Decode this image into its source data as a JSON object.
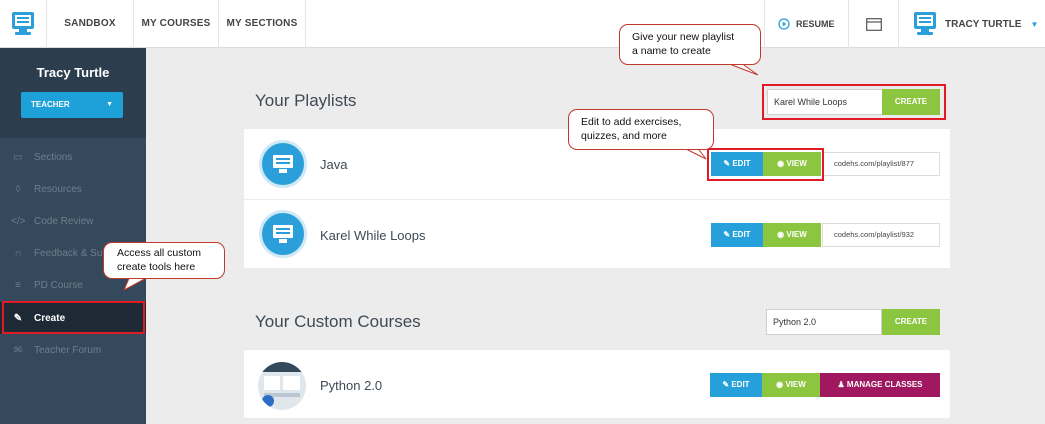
{
  "nav": {
    "items": [
      {
        "label": "SANDBOX"
      },
      {
        "label": "MY COURSES"
      },
      {
        "label": "MY SECTIONS"
      }
    ],
    "resume_label": "RESUME",
    "user_name": "TRACY TURTLE"
  },
  "sidebar": {
    "user_name": "Tracy Turtle",
    "role": "TEACHER",
    "items": [
      {
        "label": "Sections",
        "icon": "monitor-icon"
      },
      {
        "label": "Resources",
        "icon": "shield-icon"
      },
      {
        "label": "Code Review",
        "icon": "code-icon"
      },
      {
        "label": "Feedback & Su",
        "icon": "headset-icon"
      },
      {
        "label": "PD Course",
        "icon": "chalkboard-icon"
      },
      {
        "label": "Create",
        "icon": "pencil-icon"
      },
      {
        "label": "Teacher Forum",
        "icon": "chat-icon"
      }
    ]
  },
  "playlists": {
    "title": "Your Playlists",
    "create_input_value": "Karel While Loops",
    "create_label": "CREATE",
    "items": [
      {
        "name": "Java",
        "edit_label": "EDIT",
        "view_label": "VIEW",
        "url": "codehs.com/playlist/877"
      },
      {
        "name": "Karel While Loops",
        "edit_label": "EDIT",
        "view_label": "VIEW",
        "url": "codehs.com/playlist/932"
      }
    ]
  },
  "custom_courses": {
    "title": "Your Custom Courses",
    "create_input_value": "Python 2.0",
    "create_label": "CREATE",
    "items": [
      {
        "name": "Python 2.0",
        "edit_label": "EDIT",
        "view_label": "VIEW",
        "manage_label": "MANAGE CLASSES"
      }
    ]
  },
  "callouts": {
    "create_tip_line1": "Give your new playlist",
    "create_tip_line2": "a name to create",
    "edit_tip_line1": "Edit to add exercises,",
    "edit_tip_line2": "quizzes, and more",
    "sidebar_tip_line1": "Access all custom",
    "sidebar_tip_line2": "create tools here"
  },
  "colors": {
    "accent_blue": "#26a0da",
    "accent_green": "#8cc540",
    "manage_purple": "#a0185f",
    "sidebar_bg": "#34495b",
    "highlight_red": "#e01b24"
  }
}
